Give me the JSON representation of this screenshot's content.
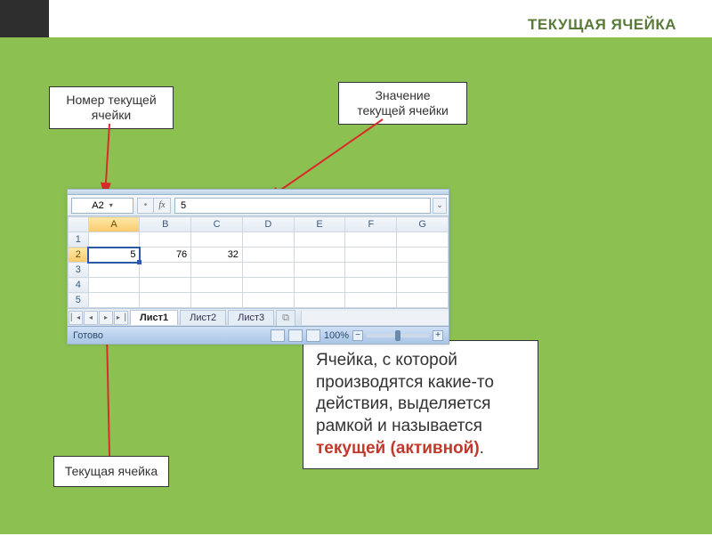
{
  "title": "ТЕКУЩАЯ ЯЧЕЙКА",
  "labels": {
    "cell_number": "Номер текущей\nячейки",
    "cell_value": "Значение\nтекущей ячейки",
    "current_cell": "Текущая ячейка"
  },
  "info": {
    "text_pre": "Ячейка, с которой производятся  какие-то действия, выделяется рамкой и называется ",
    "text_red": "текущей (активной)",
    "text_post": "."
  },
  "excel": {
    "name_box": "A2",
    "fx_label": "fx",
    "formula_value": "5",
    "columns": [
      "A",
      "B",
      "C",
      "D",
      "E",
      "F",
      "G"
    ],
    "rows": [
      "1",
      "2",
      "3",
      "4",
      "5"
    ],
    "cells": {
      "A2": "5",
      "B2": "76",
      "C2": "32"
    },
    "tabs": [
      "Лист1",
      "Лист2",
      "Лист3"
    ],
    "active_tab": 0,
    "status": "Готово",
    "zoom": "100%"
  }
}
